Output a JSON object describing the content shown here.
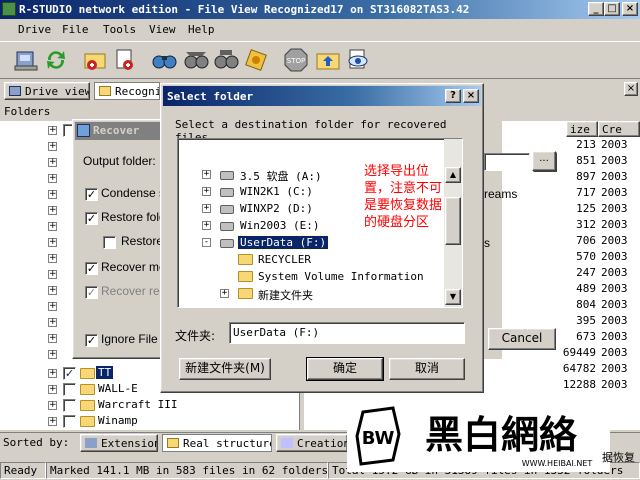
{
  "app": {
    "title": "R-STUDIO network edition - File View Recognized17 on ST316082TAS3.42",
    "menu": [
      "Drive",
      "File",
      "Tools",
      "View",
      "Help"
    ],
    "window_buttons": [
      "_",
      "□",
      "×"
    ]
  },
  "toolbar": {
    "tools": [
      "connect-icon",
      "refresh-icon",
      "open-file-icon",
      "add-file-icon",
      "scan-icon",
      "find-icon",
      "find-next-icon",
      "mark-icon",
      "stop-icon",
      "up-folder-icon",
      "preview-icon"
    ]
  },
  "tabs": [
    "Drive view",
    "Recogni"
  ],
  "left_pane": {
    "header": "Folders",
    "visible_folders": [
      "TT",
      "WALL-E",
      "Warcraft III",
      "Winamp"
    ]
  },
  "right_pane": {
    "columns": [
      "ize",
      "Cre"
    ],
    "rows": [
      {
        "size": "213",
        "created": "2003"
      },
      {
        "size": "851",
        "created": "2003"
      },
      {
        "size": "897",
        "created": "2003"
      },
      {
        "size": "717",
        "created": "2003"
      },
      {
        "size": "125",
        "created": "2003"
      },
      {
        "size": "312",
        "created": "2003"
      },
      {
        "size": "706",
        "created": "2003"
      },
      {
        "size": "570",
        "created": "2003"
      },
      {
        "size": "247",
        "created": "2003"
      },
      {
        "size": "489",
        "created": "2003"
      },
      {
        "size": "804",
        "created": "2003"
      },
      {
        "size": "395",
        "created": "2003"
      },
      {
        "size": "673",
        "created": "2003"
      },
      {
        "size": "69449",
        "created": "2003"
      },
      {
        "size": "64782",
        "created": "2003"
      },
      {
        "size": "12288",
        "created": "2003"
      }
    ]
  },
  "sort_bar": {
    "label": "Sorted by:",
    "tabs": [
      "Extension",
      "Real structure",
      "Creation"
    ]
  },
  "status": {
    "ready": "Ready",
    "marked": "Marked 141.1 MB in 583 files in 62 folders",
    "total": "Total 15.2 GB in 31389 files in 1332 folders",
    "right_fragment": "据恢复"
  },
  "recover_dialog": {
    "title": "Recover",
    "output_folder_label": "Output folder:",
    "browse_label": "...",
    "options": [
      {
        "label": "Condense s",
        "checked": true,
        "disabled": false
      },
      {
        "label": "Restore fold",
        "checked": true,
        "disabled": false
      },
      {
        "label": "Restore",
        "checked": false,
        "disabled": false
      },
      {
        "label": "Recover me",
        "checked": true,
        "disabled": false
      },
      {
        "label": "Recover rea",
        "checked": true,
        "disabled": true
      },
      {
        "label": "Ignore File M",
        "checked": true,
        "disabled": false
      }
    ],
    "streams_fragment": "reams",
    "s_fragment": "s",
    "cancel_label": "Cancel"
  },
  "select_folder_dialog": {
    "title": "Select folder",
    "help_btn": "?",
    "close_btn": "×",
    "instruction": "Select a destination folder for recovered files.",
    "tree": [
      {
        "label": "3.5 软盘 (A:)",
        "kind": "drive",
        "level": 0,
        "expander": "+",
        "selected": false
      },
      {
        "label": "WIN2K1 (C:)",
        "kind": "drive",
        "level": 0,
        "expander": "+",
        "selected": false
      },
      {
        "label": "WINXP2 (D:)",
        "kind": "drive",
        "level": 0,
        "expander": "+",
        "selected": false
      },
      {
        "label": "Win2003 (E:)",
        "kind": "drive",
        "level": 0,
        "expander": "+",
        "selected": false
      },
      {
        "label": "UserData (F:)",
        "kind": "drive",
        "level": 0,
        "expander": "-",
        "selected": true
      },
      {
        "label": "RECYCLER",
        "kind": "folder",
        "level": 1,
        "expander": "",
        "selected": false
      },
      {
        "label": "System Volume Information",
        "kind": "folder",
        "level": 1,
        "expander": "",
        "selected": false
      },
      {
        "label": "新建文件夹",
        "kind": "folder",
        "level": 1,
        "expander": "+",
        "selected": false
      }
    ],
    "annotation": "选择导出位置，注意不可是要恢复数据的硬盘分区",
    "annotation_color": "#ff0000",
    "folder_label": "文件夹:",
    "folder_value": "UserData (F:)",
    "new_folder_btn": "新建文件夹(M)",
    "ok_btn": "确定",
    "cancel_btn": "取消"
  },
  "watermark": {
    "logo_letters": "BW",
    "brand": "黑白網絡",
    "url": "WWW.HEIBAI.NET"
  },
  "colors": {
    "title_active": "#0a246a",
    "title_gradient_end": "#a6caf0",
    "selection": "#0a246a",
    "face": "#d4d0c8",
    "annotation": "#ff0000"
  }
}
